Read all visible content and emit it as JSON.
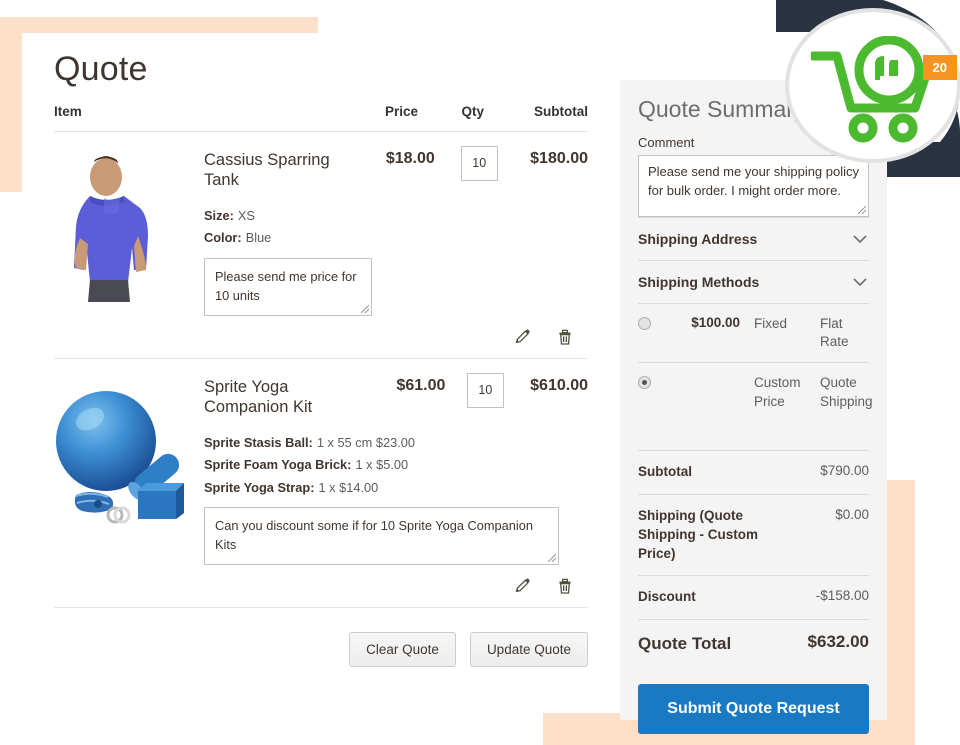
{
  "page": {
    "title": "Quote"
  },
  "table": {
    "headers": {
      "item": "Item",
      "price": "Price",
      "qty": "Qty",
      "subtotal": "Subtotal"
    }
  },
  "items": [
    {
      "name": "Cassius Sparring Tank",
      "price": "$18.00",
      "qty": "10",
      "subtotal": "$180.00",
      "image_alt": "man-in-blue-tank-top",
      "options": [
        {
          "label": "Size:",
          "value": "XS"
        },
        {
          "label": "Color:",
          "value": "Blue"
        }
      ],
      "note": "Please send me price for 10 units",
      "edit_icon": "pencil-icon",
      "delete_icon": "trash-icon"
    },
    {
      "name": "Sprite Yoga Companion Kit",
      "price": "$61.00",
      "qty": "10",
      "subtotal": "$610.00",
      "image_alt": "blue-yoga-ball-roller-strap-brick",
      "options": [
        {
          "label": "Sprite Stasis Ball:",
          "value": "1 x 55 cm $23.00"
        },
        {
          "label": "Sprite Foam Yoga Brick:",
          "value": "1 x $5.00"
        },
        {
          "label": "Sprite Yoga Strap:",
          "value": "1 x $14.00"
        }
      ],
      "note": "Can you discount some if for 10 Sprite Yoga Companion Kits",
      "edit_icon": "pencil-icon",
      "delete_icon": "trash-icon"
    }
  ],
  "actions": {
    "clear_quote": "Clear Quote",
    "update_quote": "Update Quote"
  },
  "summary": {
    "title": "Quote Summary",
    "comment_label": "Comment",
    "comment_value": "Please send me your shipping policy for bulk order. I might order more.",
    "accordions": [
      {
        "label": "Shipping Address",
        "icon": "chevron-down-icon"
      },
      {
        "label": "Shipping Methods",
        "icon": "chevron-down-icon"
      }
    ],
    "shipping_methods": [
      {
        "selected": false,
        "price": "$100.00",
        "carrier": "Fixed",
        "method": "Flat Rate"
      },
      {
        "selected": true,
        "price": "",
        "carrier": "Custom Price",
        "method": "Quote Shipping"
      }
    ],
    "totals": [
      {
        "label": "Subtotal",
        "value": "$790.00",
        "grand": false
      },
      {
        "label": "Shipping (Quote Shipping - Custom Price)",
        "value": "$0.00",
        "grand": false
      },
      {
        "label": "Discount",
        "value": "-$158.00",
        "grand": false
      },
      {
        "label": "Quote Total",
        "value": "$632.00",
        "grand": true
      }
    ],
    "submit_label": "Submit Quote Request"
  },
  "badge": {
    "count": "20",
    "icon": "quote-cart-icon"
  },
  "colors": {
    "accent_blue": "#1979c3",
    "badge_orange": "#f79421",
    "cart_green": "#4cba2e",
    "peach": "#fbdfc9",
    "navy": "#2a3342"
  }
}
